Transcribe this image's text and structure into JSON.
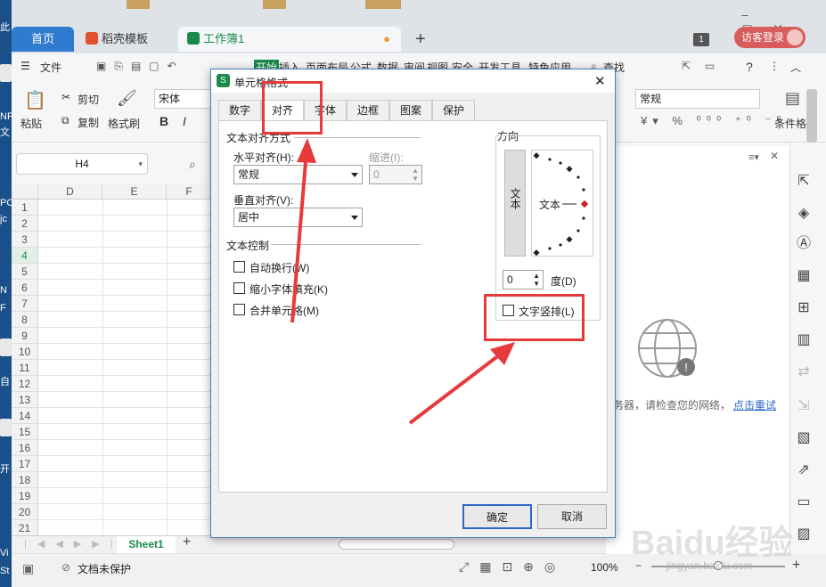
{
  "desktop": {
    "fragments": [
      "此",
      "NF",
      "文",
      "PC",
      "jc",
      "N",
      "F",
      "自",
      "开",
      "Vi",
      "St"
    ]
  },
  "window": {
    "tabs": [
      {
        "label": "首页"
      },
      {
        "label": "稻壳模板"
      },
      {
        "label": "工作簿1"
      }
    ],
    "new_tab": "+",
    "badge": "1",
    "login": "访客登录"
  },
  "menu": {
    "file": "文件",
    "items": [
      "开始",
      "插入",
      "页面布局",
      "公式",
      "数据",
      "审阅",
      "视图",
      "安全",
      "开发工具",
      "特色应用"
    ],
    "search": "查找",
    "help": "?"
  },
  "ribbon": {
    "paste": "粘贴",
    "cut": "剪切",
    "copy": "复制",
    "format_painter": "格式刷",
    "font_name": "宋体",
    "bold": "B",
    "italic": "I",
    "number_format": "常规",
    "conditional": "条件格"
  },
  "formula_bar": {
    "cell_ref": "H4"
  },
  "sheet": {
    "columns": [
      "D",
      "E",
      "F"
    ],
    "rows": [
      "1",
      "2",
      "3",
      "4",
      "5",
      "6",
      "7",
      "8",
      "9",
      "10",
      "11",
      "12",
      "13",
      "14",
      "15",
      "16",
      "17",
      "18",
      "19",
      "20",
      "21"
    ],
    "selected_row": "4",
    "tab": "Sheet1",
    "add": "+"
  },
  "status": {
    "protect": "文档未保护",
    "zoom": "100%"
  },
  "right_panel": {
    "message": "务器，请检查您的网络，",
    "retry": "点击重试"
  },
  "dialog": {
    "title": "单元格格式",
    "tabs": [
      "数字",
      "对齐",
      "字体",
      "边框",
      "图案",
      "保护"
    ],
    "active_tab": "对齐",
    "text_align_group": "文本对齐方式",
    "h_align_label": "水平对齐(H):",
    "h_align_value": "常规",
    "indent_label": "缩进(I):",
    "indent_value": "0",
    "v_align_label": "垂直对齐(V):",
    "v_align_value": "居中",
    "text_control_group": "文本控制",
    "wrap": "自动换行(W)",
    "shrink": "缩小字体填充(K)",
    "merge": "合并单元格(M)",
    "orientation_group": "方向",
    "vertical_text_box": "文本",
    "dial_text": "文本",
    "degree_value": "0",
    "degree_label": "度(D)",
    "vertical_text": "文字竖排(L)",
    "ok": "确定",
    "cancel": "取消"
  },
  "watermark": {
    "text": "Baidu经验",
    "sub": "jingyan.baidu.com"
  },
  "colors": {
    "accent": "#2e7bcf",
    "red": "#e83a3a",
    "green": "#1a8a4a"
  }
}
